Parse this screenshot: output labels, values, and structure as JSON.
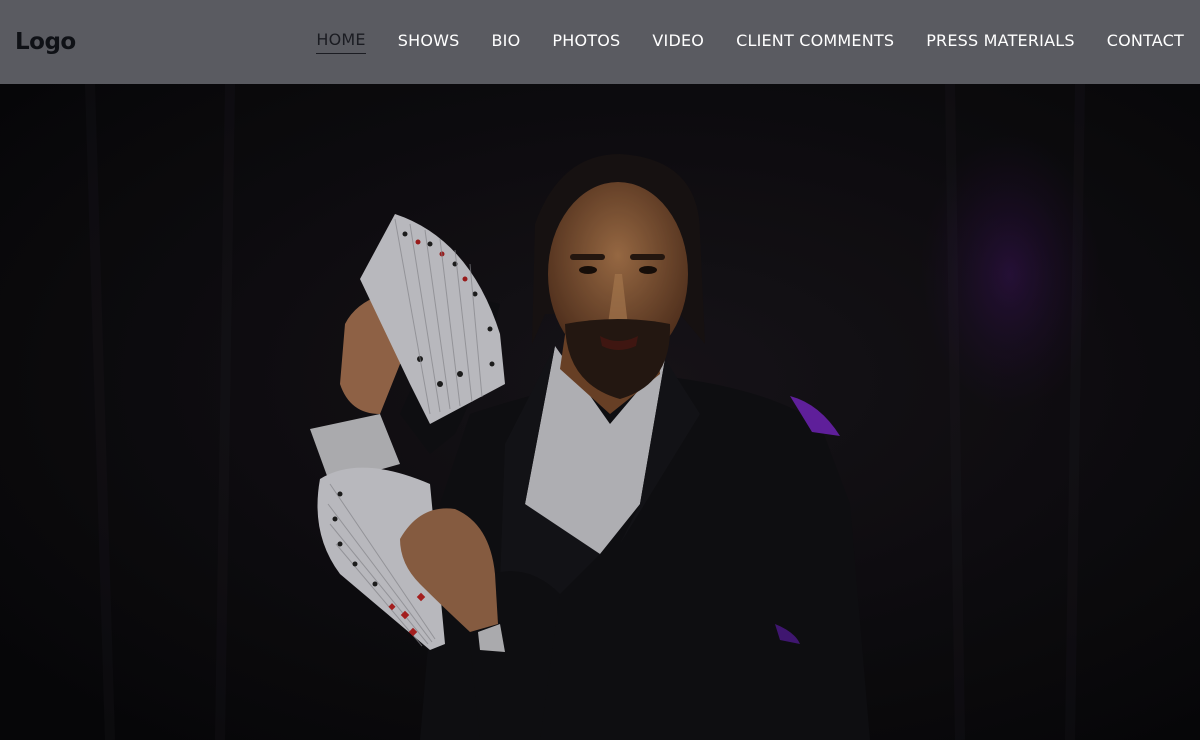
{
  "header": {
    "logo": "Logo",
    "nav": [
      {
        "label": "HOME",
        "active": true
      },
      {
        "label": "SHOWS"
      },
      {
        "label": "BIO"
      },
      {
        "label": "PHOTOS"
      },
      {
        "label": "VIDEO"
      },
      {
        "label": "CLIENT COMMENTS"
      },
      {
        "label": "PRESS MATERIALS"
      },
      {
        "label": "CONTACT"
      }
    ]
  },
  "colors": {
    "navbar_bg": "#5a5b61",
    "active_link": "#1b1c22",
    "link": "#ffffff",
    "hero_bg": "#0c0c0e"
  },
  "hero": {
    "image": "magician-with-fanned-cards"
  }
}
